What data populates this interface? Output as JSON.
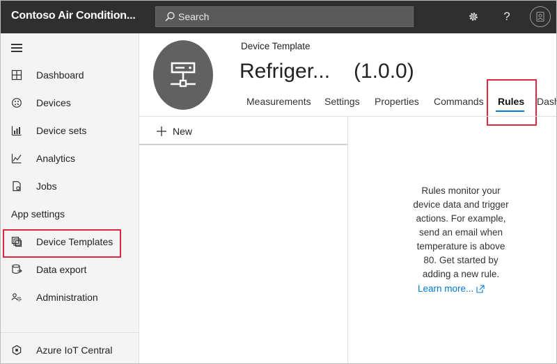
{
  "app": {
    "title": "Contoso Air Condition..."
  },
  "search": {
    "placeholder": "Search"
  },
  "sidebar": {
    "items": [
      {
        "label": "Dashboard",
        "icon": "dashboard-icon"
      },
      {
        "label": "Devices",
        "icon": "devices-icon"
      },
      {
        "label": "Device sets",
        "icon": "device-sets-icon"
      },
      {
        "label": "Analytics",
        "icon": "analytics-icon"
      },
      {
        "label": "Jobs",
        "icon": "jobs-icon"
      }
    ],
    "section_label": "App settings",
    "settings_items": [
      {
        "label": "Device Templates",
        "icon": "device-templates-icon"
      },
      {
        "label": "Data export",
        "icon": "data-export-icon"
      },
      {
        "label": "Administration",
        "icon": "administration-icon"
      }
    ],
    "footer_label": "Azure IoT Central"
  },
  "header": {
    "label": "Device Template",
    "name": "Refriger...",
    "version": "(1.0.0)",
    "tabs": [
      "Measurements",
      "Settings",
      "Properties",
      "Commands",
      "Rules",
      "Dash"
    ],
    "active_tab": "Rules"
  },
  "content": {
    "new_label": "New",
    "empty_message": [
      "Rules monitor your",
      "device data and trigger",
      "actions. For example,",
      "send an email when",
      "temperature is above",
      "80. Get started by",
      "adding a new rule."
    ],
    "learn_more": "Learn more..."
  },
  "colors": {
    "accent": "#0078d4",
    "highlight": "#e0263f",
    "topbar": "#2f2f2f"
  }
}
